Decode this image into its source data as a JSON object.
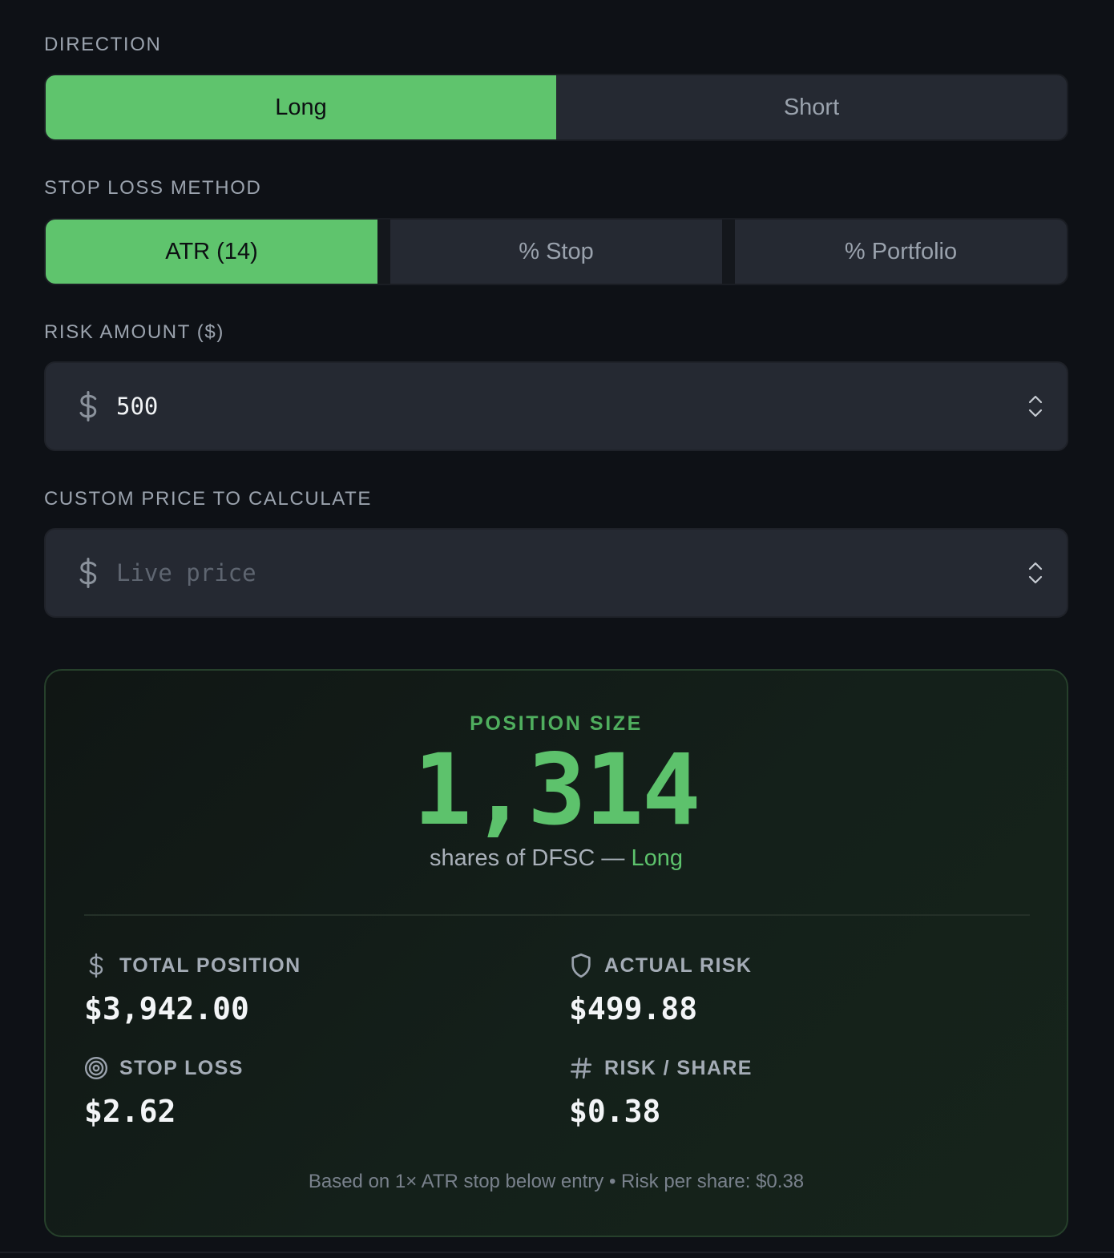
{
  "direction": {
    "label": "DIRECTION",
    "options": [
      {
        "label": "Long",
        "active": true
      },
      {
        "label": "Short",
        "active": false
      }
    ]
  },
  "stop_loss_method": {
    "label": "STOP LOSS METHOD",
    "options": [
      {
        "label": "ATR (14)",
        "active": true
      },
      {
        "label": "% Stop",
        "active": false
      },
      {
        "label": "% Portfolio",
        "active": false
      }
    ]
  },
  "risk_amount": {
    "label": "RISK AMOUNT ($)",
    "value": "500",
    "placeholder": ""
  },
  "custom_price": {
    "label": "CUSTOM PRICE TO CALCULATE",
    "value": "",
    "placeholder": "Live price"
  },
  "result": {
    "label": "POSITION SIZE",
    "value": "1,314",
    "subtitle_prefix": "shares of DFSC —",
    "subtitle_direction": "Long",
    "stats": {
      "total_position": {
        "label": "TOTAL POSITION",
        "value": "$3,942.00",
        "icon": "dollar-icon"
      },
      "actual_risk": {
        "label": "ACTUAL RISK",
        "value": "$499.88",
        "icon": "shield-icon"
      },
      "stop_loss": {
        "label": "STOP LOSS",
        "value": "$2.62",
        "icon": "target-icon"
      },
      "risk_per_share": {
        "label": "RISK / SHARE",
        "value": "$0.38",
        "icon": "hash-icon"
      }
    },
    "footnote": "Based on 1× ATR stop below entry • Risk per share: $0.38"
  },
  "colors": {
    "accent": "#5fc46d",
    "background": "#0e1116",
    "control": "#252932"
  }
}
